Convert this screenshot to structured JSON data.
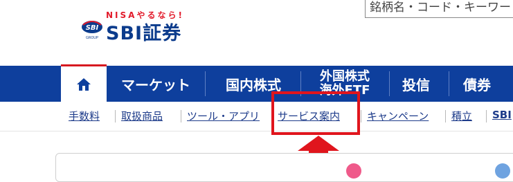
{
  "logo": {
    "tagline": "NISAやるなら!",
    "brand": "SBI証券",
    "mark_text": "SBI",
    "mark_sub": "GROUP"
  },
  "search": {
    "placeholder": "銘柄名・コード・キーワード"
  },
  "main_nav": {
    "items": [
      {
        "label": "マーケット"
      },
      {
        "label": "国内株式"
      },
      {
        "label_line1": "外国株式",
        "label_line2": "海外ETF"
      },
      {
        "label": "投信"
      },
      {
        "label": "債券"
      }
    ]
  },
  "sub_nav": {
    "items": [
      {
        "label": "手数料"
      },
      {
        "label": "取扱商品"
      },
      {
        "label": "ツール・アプリ"
      },
      {
        "label": "サービス案内"
      },
      {
        "label": "キャンペーン"
      },
      {
        "label": "積立"
      },
      {
        "label": "SBI"
      }
    ]
  },
  "colors": {
    "nav_bg": "#0e3f9d",
    "brand_blue": "#0b3b8c",
    "brand_red": "#e21b2b",
    "annotation_red": "#e0151d",
    "link": "#1d3b8a"
  },
  "icons": {
    "home": "home-icon",
    "annotation": "red-arrow-icon"
  }
}
